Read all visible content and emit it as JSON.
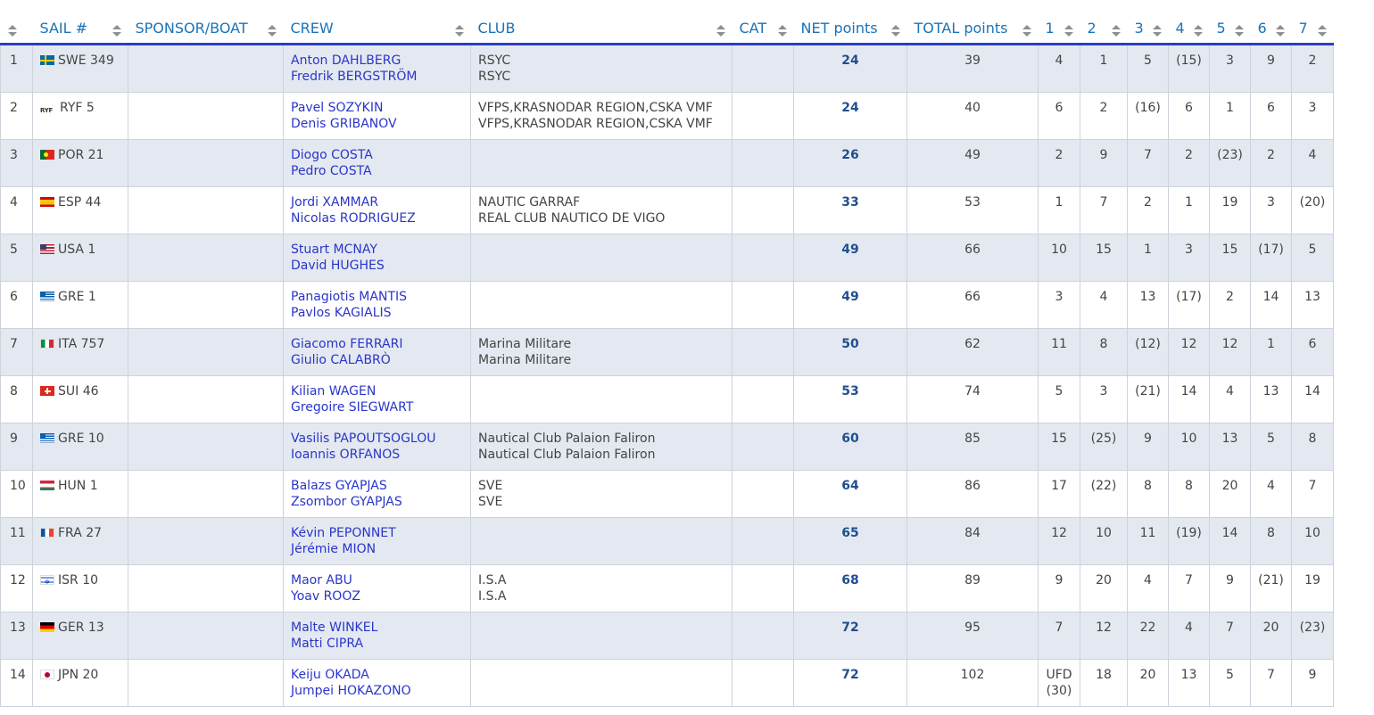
{
  "headers": {
    "rank": "",
    "sail": "SAIL #",
    "sponsor": "SPONSOR/BOAT",
    "crew": "CREW",
    "club": "CLUB",
    "cat": "CAT",
    "net": "NET points",
    "total": "TOTAL points",
    "races": [
      "1",
      "2",
      "3",
      "4",
      "5",
      "6",
      "7"
    ]
  },
  "rows": [
    {
      "rank": "1",
      "flag": "SWE",
      "sail": "SWE 349",
      "sponsor": "",
      "crew": [
        "Anton DAHLBERG",
        "Fredrik BERGSTRÖM"
      ],
      "club": [
        "RSYC",
        "RSYC"
      ],
      "cat": "",
      "net": "24",
      "total": "39",
      "races": [
        "4",
        "1",
        "5",
        "(15)",
        "3",
        "9",
        "2"
      ]
    },
    {
      "rank": "2",
      "flag": "RYF",
      "flag_text": "RYF",
      "sail": "RYF 5",
      "sponsor": "",
      "crew": [
        "Pavel SOZYKIN",
        "Denis GRIBANOV"
      ],
      "club": [
        "VFPS,KRASNODAR REGION,CSKA VMF",
        "VFPS,KRASNODAR REGION,CSKA VMF"
      ],
      "cat": "",
      "net": "24",
      "total": "40",
      "races": [
        "6",
        "2",
        "(16)",
        "6",
        "1",
        "6",
        "3"
      ]
    },
    {
      "rank": "3",
      "flag": "POR",
      "sail": "POR 21",
      "sponsor": "",
      "crew": [
        "Diogo COSTA",
        "Pedro COSTA"
      ],
      "club": [
        "",
        ""
      ],
      "cat": "",
      "net": "26",
      "total": "49",
      "races": [
        "2",
        "9",
        "7",
        "2",
        "(23)",
        "2",
        "4"
      ]
    },
    {
      "rank": "4",
      "flag": "ESP",
      "sail": "ESP 44",
      "sponsor": "",
      "crew": [
        "Jordi XAMMAR",
        "Nicolas RODRIGUEZ"
      ],
      "club": [
        "NAUTIC GARRAF",
        "REAL CLUB NAUTICO DE VIGO"
      ],
      "cat": "",
      "net": "33",
      "total": "53",
      "races": [
        "1",
        "7",
        "2",
        "1",
        "19",
        "3",
        "(20)"
      ]
    },
    {
      "rank": "5",
      "flag": "USA",
      "sail": "USA 1",
      "sponsor": "",
      "crew": [
        "Stuart MCNAY",
        "David HUGHES"
      ],
      "club": [
        "",
        ""
      ],
      "cat": "",
      "net": "49",
      "total": "66",
      "races": [
        "10",
        "15",
        "1",
        "3",
        "15",
        "(17)",
        "5"
      ]
    },
    {
      "rank": "6",
      "flag": "GRE",
      "sail": "GRE 1",
      "sponsor": "",
      "crew": [
        "Panagiotis MANTIS",
        "Pavlos KAGIALIS"
      ],
      "club": [
        "",
        ""
      ],
      "cat": "",
      "net": "49",
      "total": "66",
      "races": [
        "3",
        "4",
        "13",
        "(17)",
        "2",
        "14",
        "13"
      ]
    },
    {
      "rank": "7",
      "flag": "ITA",
      "sail": "ITA 757",
      "sponsor": "",
      "crew": [
        "Giacomo FERRARI",
        "Giulio CALABRÒ"
      ],
      "club": [
        "Marina Militare",
        "Marina Militare"
      ],
      "cat": "",
      "net": "50",
      "total": "62",
      "races": [
        "11",
        "8",
        "(12)",
        "12",
        "12",
        "1",
        "6"
      ]
    },
    {
      "rank": "8",
      "flag": "SUI",
      "sail": "SUI 46",
      "sponsor": "",
      "crew": [
        "Kilian WAGEN",
        "Gregoire SIEGWART"
      ],
      "club": [
        "",
        ""
      ],
      "cat": "",
      "net": "53",
      "total": "74",
      "races": [
        "5",
        "3",
        "(21)",
        "14",
        "4",
        "13",
        "14"
      ]
    },
    {
      "rank": "9",
      "flag": "GRE",
      "sail": "GRE 10",
      "sponsor": "",
      "crew": [
        "Vasilis PAPOUTSOGLOU",
        "Ioannis ORFANOS"
      ],
      "club": [
        "Nautical Club Palaion Faliron",
        "Nautical Club Palaion Faliron"
      ],
      "cat": "",
      "net": "60",
      "total": "85",
      "races": [
        "15",
        "(25)",
        "9",
        "10",
        "13",
        "5",
        "8"
      ]
    },
    {
      "rank": "10",
      "flag": "HUN",
      "sail": "HUN 1",
      "sponsor": "",
      "crew": [
        "Balazs GYAPJAS",
        "Zsombor GYAPJAS"
      ],
      "club": [
        "SVE",
        "SVE"
      ],
      "cat": "",
      "net": "64",
      "total": "86",
      "races": [
        "17",
        "(22)",
        "8",
        "8",
        "20",
        "4",
        "7"
      ]
    },
    {
      "rank": "11",
      "flag": "FRA",
      "sail": "FRA 27",
      "sponsor": "",
      "crew": [
        "Kévin PEPONNET",
        "Jérémie MION"
      ],
      "club": [
        "",
        ""
      ],
      "cat": "",
      "net": "65",
      "total": "84",
      "races": [
        "12",
        "10",
        "11",
        "(19)",
        "14",
        "8",
        "10"
      ]
    },
    {
      "rank": "12",
      "flag": "ISR",
      "sail": "ISR 10",
      "sponsor": "",
      "crew": [
        "Maor ABU",
        "Yoav ROOZ"
      ],
      "club": [
        "I.S.A",
        "I.S.A"
      ],
      "cat": "",
      "net": "68",
      "total": "89",
      "races": [
        "9",
        "20",
        "4",
        "7",
        "9",
        "(21)",
        "19"
      ]
    },
    {
      "rank": "13",
      "flag": "GER",
      "sail": "GER 13",
      "sponsor": "",
      "crew": [
        "Malte WINKEL",
        "Matti CIPRA"
      ],
      "club": [
        "",
        ""
      ],
      "cat": "",
      "net": "72",
      "total": "95",
      "races": [
        "7",
        "12",
        "22",
        "4",
        "7",
        "20",
        "(23)"
      ]
    },
    {
      "rank": "14",
      "flag": "JPN",
      "sail": "JPN 20",
      "sponsor": "",
      "crew": [
        "Keiju OKADA",
        "Jumpei HOKAZONO"
      ],
      "club": [
        "",
        ""
      ],
      "cat": "",
      "net": "72",
      "total": "102",
      "races": [
        "UFD\n(30)",
        "18",
        "20",
        "13",
        "5",
        "7",
        "9"
      ]
    }
  ]
}
